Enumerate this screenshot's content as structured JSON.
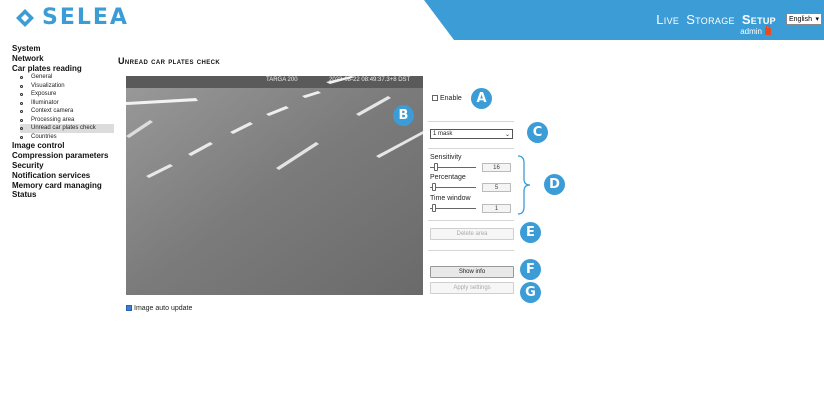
{
  "header": {
    "brand": "SELEA",
    "nav": [
      "Live",
      "Storage",
      "Setup"
    ],
    "active_nav": "Setup",
    "language": "English",
    "user": "admin",
    "accent_color": "#3c9cd6"
  },
  "sidebar": {
    "sections": [
      {
        "label": "System"
      },
      {
        "label": "Network"
      },
      {
        "label": "Car plates reading",
        "children": [
          {
            "label": "General"
          },
          {
            "label": "Visualization"
          },
          {
            "label": "Exposure"
          },
          {
            "label": "Illuminator"
          },
          {
            "label": "Context camera"
          },
          {
            "label": "Processing area"
          },
          {
            "label": "Unread car plates check",
            "active": true
          },
          {
            "label": "Countries"
          }
        ]
      },
      {
        "label": "Image control"
      },
      {
        "label": "Compression parameters"
      },
      {
        "label": "Security"
      },
      {
        "label": "Notification services"
      },
      {
        "label": "Memory card managing"
      },
      {
        "label": "Status"
      }
    ]
  },
  "page": {
    "title": "Unread car plates check"
  },
  "camera": {
    "overlay_left": "TARGA 200",
    "overlay_right": "2023-08-22 08:49:37.3+8 DST"
  },
  "controls": {
    "enable_label": "Enable",
    "enable_checked": false,
    "mask_select": "1 mask",
    "sensitivity_label": "Sensitivity",
    "sensitivity_value": "16",
    "sensitivity_fraction": 0.1,
    "percentage_label": "Percentage",
    "percentage_value": "5",
    "percentage_fraction": 0.05,
    "time_window_label": "Time window",
    "time_window_value": "1",
    "time_window_fraction": 0.05,
    "delete_area_label": "Delete area",
    "show_info_label": "Show info",
    "apply_settings_label": "Apply settings",
    "image_auto_update_label": "Image auto update",
    "image_auto_update_checked": true
  },
  "callouts": [
    "A",
    "B",
    "C",
    "D",
    "E",
    "F",
    "G"
  ]
}
